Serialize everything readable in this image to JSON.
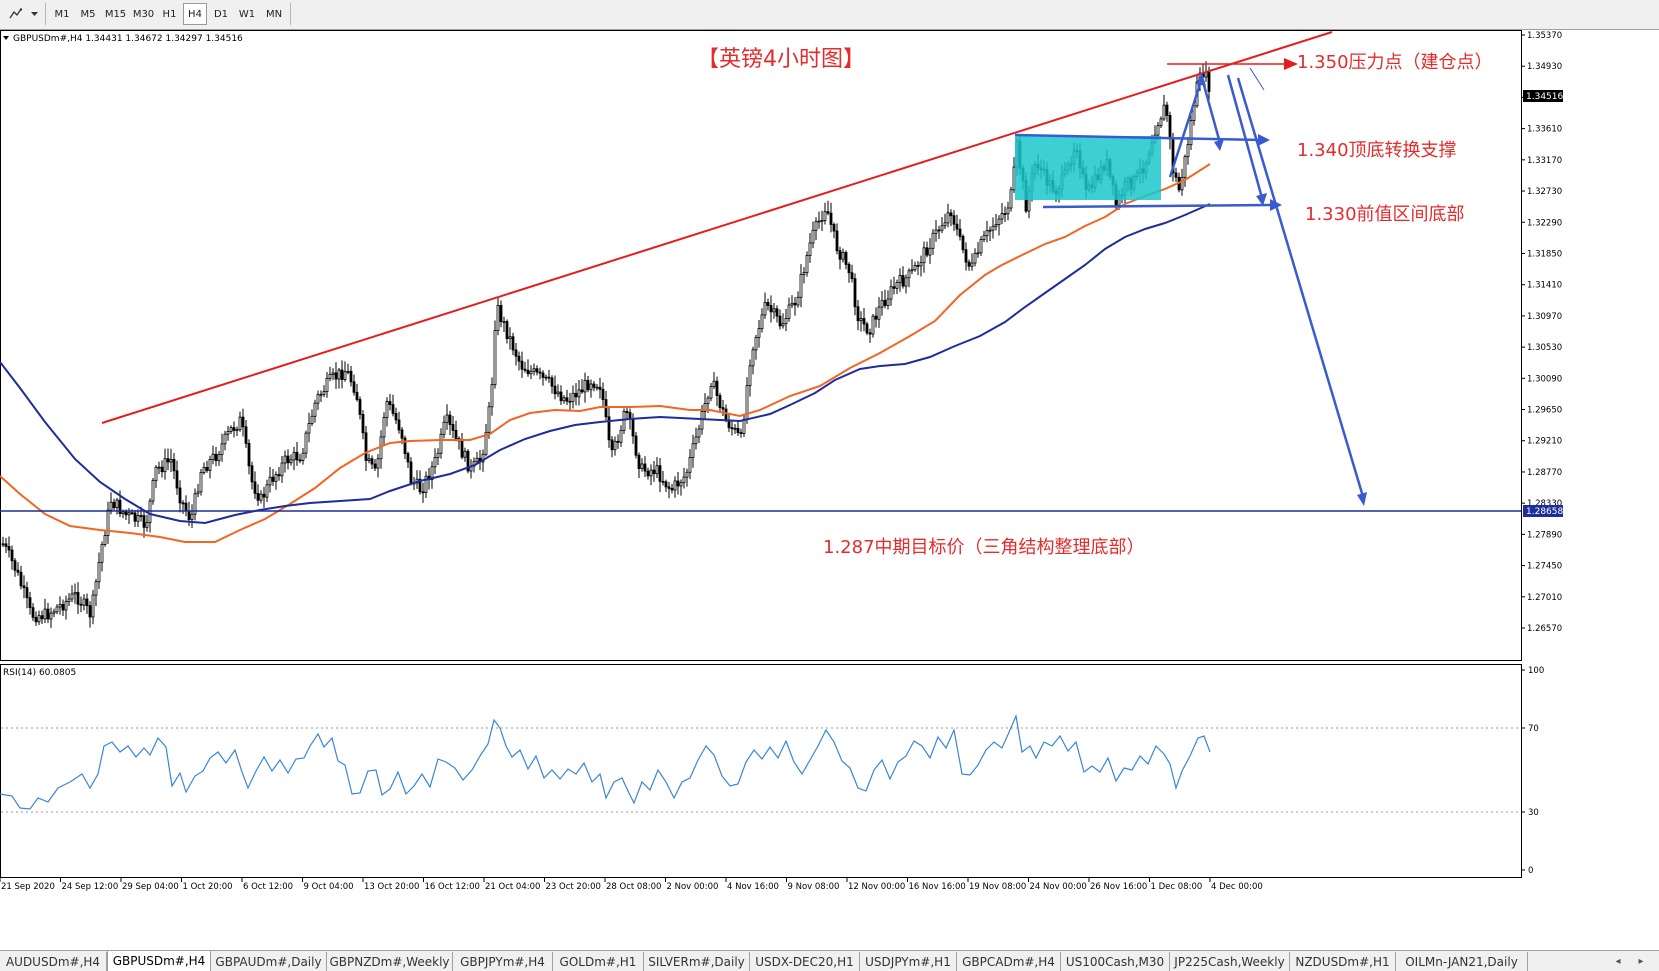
{
  "toolbar": {
    "timeframes": [
      "M1",
      "M5",
      "M15",
      "M30",
      "H1",
      "H4",
      "D1",
      "W1",
      "MN"
    ],
    "active_timeframe": "H4",
    "tools_icon": "crosshair-tools-icon",
    "dropdown_icon": "chevron-down-icon"
  },
  "chart": {
    "header": "GBPUSDm#,H4  1.34431 1.34672 1.34297 1.34516",
    "title": "【英镑4小时图】",
    "bid_label": "1.34516",
    "hline_label": "1.28658",
    "price_axis": [
      "1.35370",
      "1.34930",
      "1.34050",
      "1.33610",
      "1.33170",
      "1.32730",
      "1.32290",
      "1.31850",
      "1.31410",
      "1.30970",
      "1.30530",
      "1.30090",
      "1.29650",
      "1.29210",
      "1.28770",
      "1.28330",
      "1.27890",
      "1.27450",
      "1.27010",
      "1.26570"
    ],
    "annotations": {
      "resistance": "1.350压力点（建仓点）",
      "support_flip": "1.340顶底转换支撑",
      "range_bottom": "1.330前值区间底部",
      "target": "1.287中期目标价（三角结构整理底部）"
    },
    "colors": {
      "trendline": "#e51c1c",
      "annotation_text": "#e52b2b",
      "ma_fast": "#f26522",
      "ma_slow": "#1e2c9c",
      "hline": "#1e2c9c",
      "arrows": "#3a5bd0",
      "box": "#1ac8cc",
      "candles": "#000000",
      "rsi_line": "#3a86d4"
    }
  },
  "rsi": {
    "header": "RSI(14) 60.0805",
    "axis": [
      "100",
      "70",
      "30",
      "0"
    ]
  },
  "time_axis": [
    "21 Sep 2020",
    "24 Sep 12:00",
    "29 Sep 04:00",
    "1 Oct 20:00",
    "6 Oct 12:00",
    "9 Oct 04:00",
    "13 Oct 20:00",
    "16 Oct 12:00",
    "21 Oct 04:00",
    "23 Oct 20:00",
    "28 Oct 08:00",
    "2 Nov 00:00",
    "4 Nov 16:00",
    "9 Nov 08:00",
    "12 Nov 00:00",
    "16 Nov 16:00",
    "19 Nov 08:00",
    "24 Nov 00:00",
    "26 Nov 16:00",
    "1 Dec 08:00",
    "4 Dec 00:00"
  ],
  "tabs": [
    "AUDUSDm#,H4",
    "GBPUSDm#,H4",
    "GBPAUDm#,Daily",
    "GBPNZDm#,Weekly",
    "GBPJPYm#,H4",
    "GOLDm#,H1",
    "SILVERm#,Daily",
    "USDX-DEC20,H1",
    "USDJPYm#,H1",
    "GBPCADm#,H4",
    "US100Cash,M30",
    "JP225Cash,Weekly",
    "NZDUSDm#,H1",
    "OILMn-JAN21,Daily"
  ],
  "active_tab": "GBPUSDm#,H4",
  "tab_scroll": {
    "left": "◂",
    "right": "▸"
  }
}
